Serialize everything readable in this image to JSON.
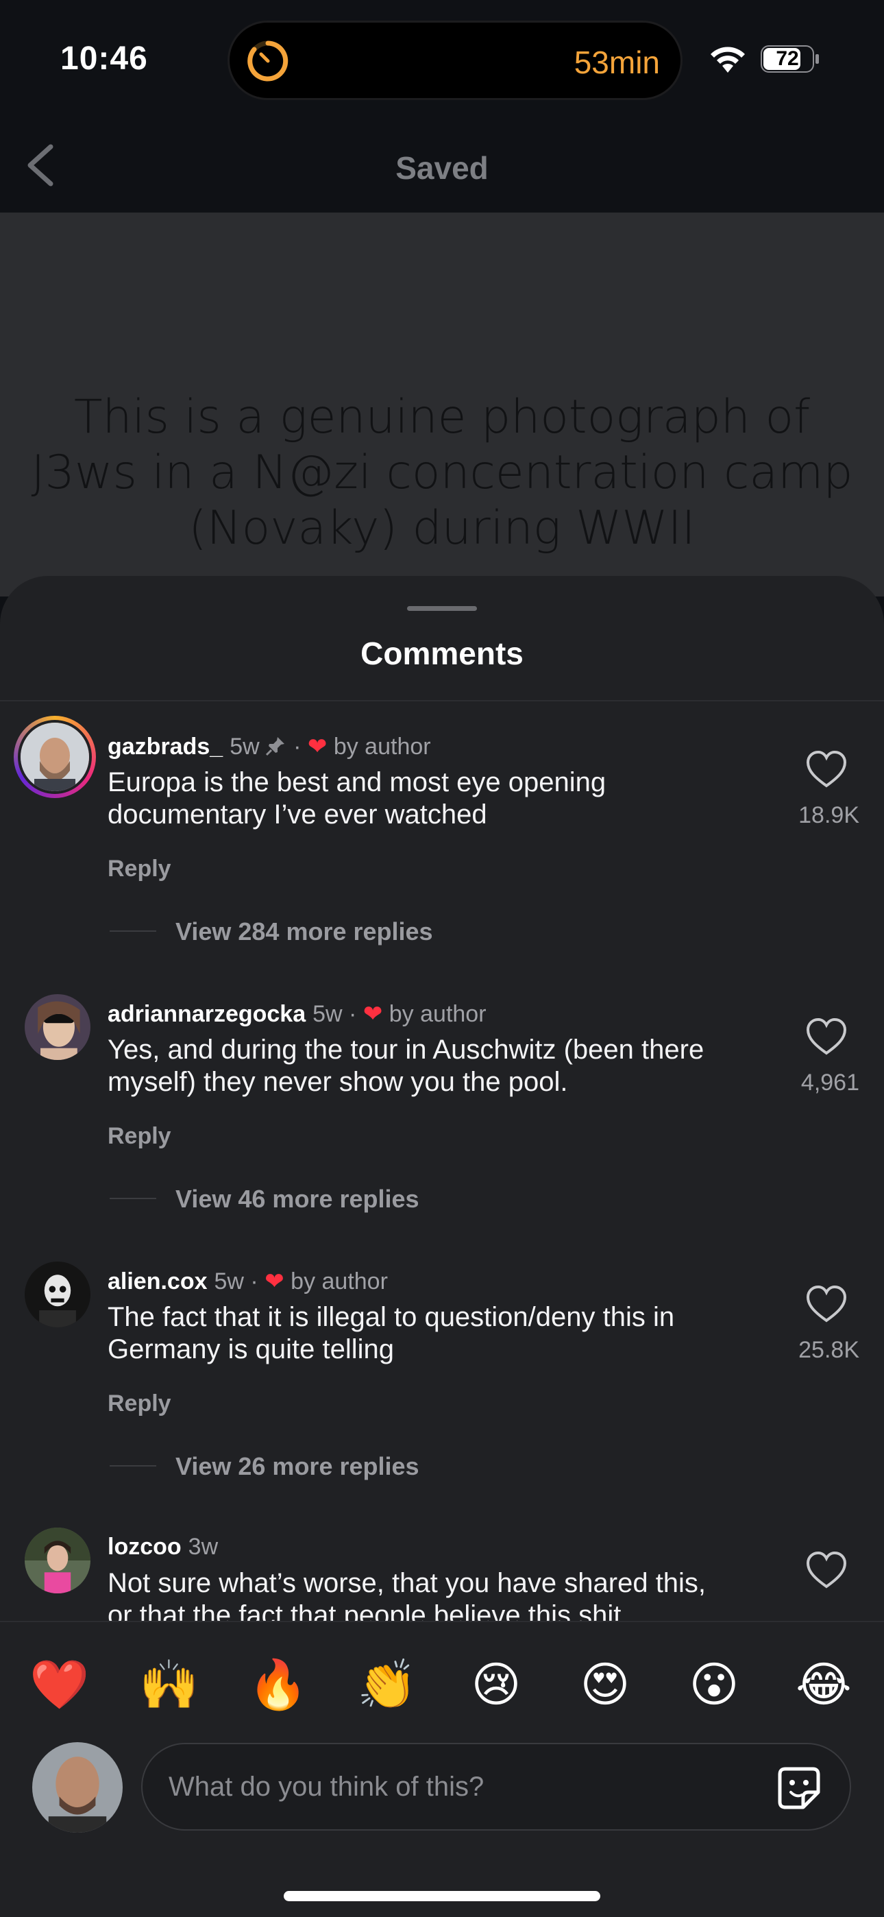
{
  "status_bar": {
    "time": "10:46",
    "timer_text": "53min",
    "battery": "72"
  },
  "nav": {
    "title": "Saved"
  },
  "post": {
    "lines": [
      "This is a genuine photograph of",
      "J3ws in a N@zi concentration camp",
      "(Novaky) during WWII"
    ]
  },
  "sheet": {
    "title": "Comments"
  },
  "comments": [
    {
      "user": "gazbrads_",
      "age": "5w",
      "pinned": true,
      "liked_by_author": "by author",
      "text": "Europa is the best and most eye opening documentary I’ve ever watched",
      "reply": "Reply",
      "likes": "18.9K",
      "more": "View 284 more replies"
    },
    {
      "user": "adriannarzegocka",
      "age": "5w",
      "liked_by_author": "by author",
      "text": "Yes, and during the tour in Auschwitz (been there myself) they never show you the pool.",
      "reply": "Reply",
      "likes": "4,961",
      "more": "View 46 more replies"
    },
    {
      "user": "alien.cox",
      "age": "5w",
      "liked_by_author": "by author",
      "text": "The fact that it is illegal to question/deny this in Germany is quite telling",
      "reply": "Reply",
      "likes": "25.8K",
      "more": "View 26 more replies"
    },
    {
      "user": "lozcoo",
      "age": "3w",
      "text": "Not sure what’s worse, that you have shared this,",
      "text_cut": "or that the fact that people believe this shit..."
    }
  ],
  "emojis": [
    "❤️",
    "🙌",
    "🔥",
    "👏",
    "😢",
    "😍",
    "😮",
    "😂"
  ],
  "composer": {
    "placeholder": "What do you think of this?"
  },
  "colors": {
    "accent_orange": "#f5a43a",
    "heart_red": "#ff3040",
    "sheet_bg": "#202124"
  }
}
